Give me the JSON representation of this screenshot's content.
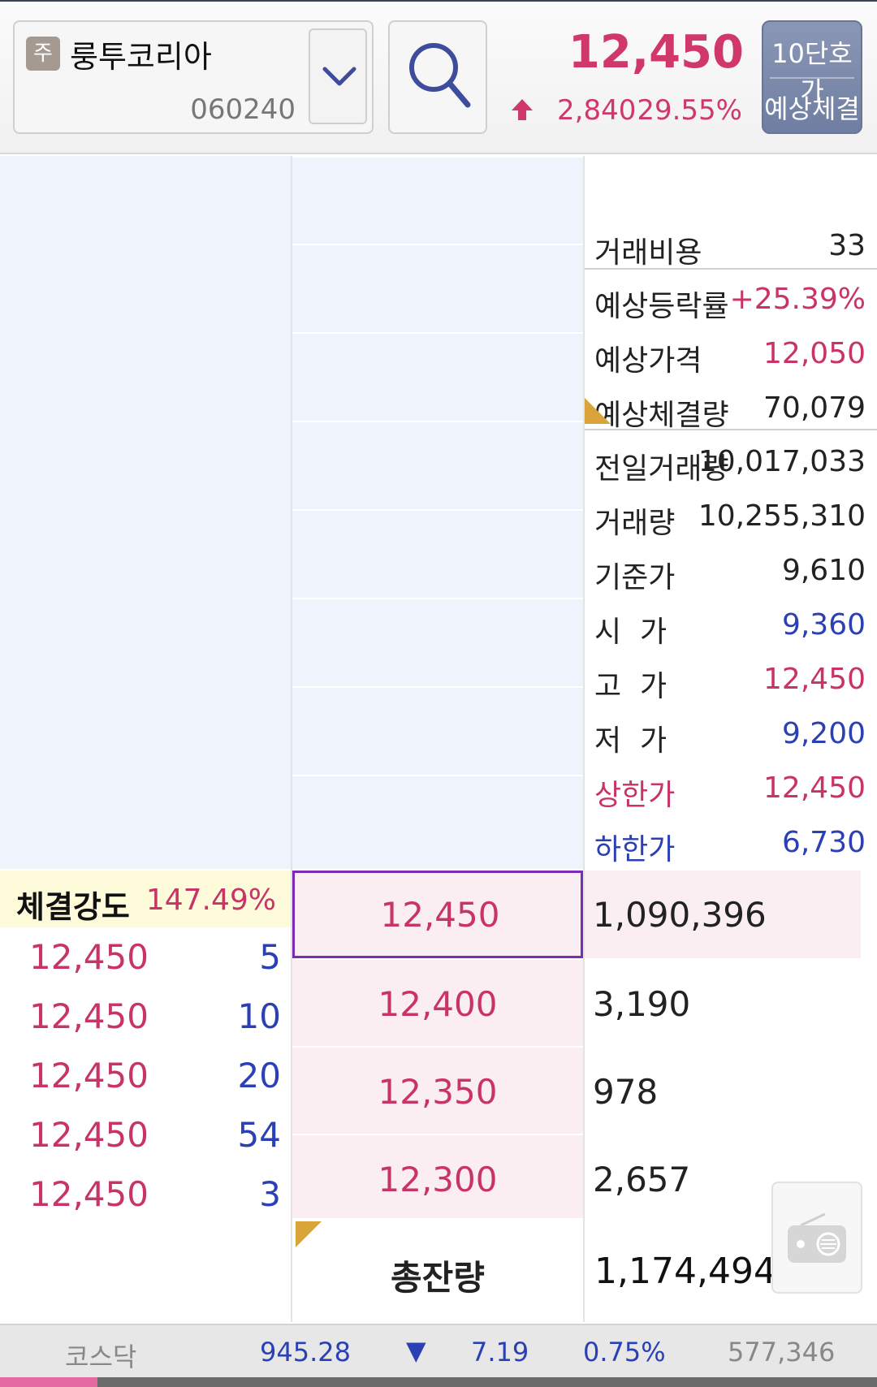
{
  "header": {
    "stock_badge": "주",
    "stock_name": "룽투코리아",
    "stock_code": "060240",
    "current_price": "12,450",
    "change": "2,840",
    "change_rate": "29.55%",
    "btn_10_line1": "10단호가",
    "btn_10_line2": "예상체결",
    "icons": [
      "chevron-down-icon",
      "search-icon",
      "up-arrow-icon"
    ],
    "colors": {
      "up": "#d0386a",
      "down": "#2a40b4",
      "button": "#7a88ab"
    }
  },
  "info": {
    "fee": {
      "label": "거래비용",
      "value": "33"
    },
    "expected_rate": {
      "label": "예상등락률",
      "value": "+25.39%"
    },
    "expected_price": {
      "label": "예상가격",
      "value": "12,050"
    },
    "expected_volume": {
      "label": "예상체결량",
      "value": "70,079"
    },
    "prev_volume": {
      "label": "전일거래량",
      "value": "10,017,033"
    },
    "volume": {
      "label": "거래량",
      "value": "10,255,310"
    },
    "base_price": {
      "label": "기준가",
      "value": "9,610"
    },
    "open": {
      "label": "시  가",
      "value": "9,360"
    },
    "high": {
      "label": "고  가",
      "value": "12,450"
    },
    "low": {
      "label": "저  가",
      "value": "9,200"
    },
    "upper_limit": {
      "label": "상한가",
      "value": "12,450"
    },
    "lower_limit": {
      "label": "하한가",
      "value": "6,730"
    }
  },
  "strength": {
    "label": "체결강도",
    "value": "147.49%"
  },
  "ticks": [
    {
      "price": "12,450",
      "qty": "5"
    },
    {
      "price": "12,450",
      "qty": "10"
    },
    {
      "price": "12,450",
      "qty": "20"
    },
    {
      "price": "12,450",
      "qty": "54"
    },
    {
      "price": "12,450",
      "qty": "3"
    }
  ],
  "bids": [
    {
      "price": "12,450",
      "qty": "1,090,396"
    },
    {
      "price": "12,400",
      "qty": "3,190"
    },
    {
      "price": "12,350",
      "qty": "978"
    },
    {
      "price": "12,300",
      "qty": "2,657"
    }
  ],
  "total": {
    "label": "총잔량",
    "value": "1,174,494"
  },
  "ticker": {
    "name": "코스닥",
    "index": "945.28",
    "arrow": "▼",
    "change": "7.19",
    "rate": "0.75%",
    "volume": "577,346"
  }
}
